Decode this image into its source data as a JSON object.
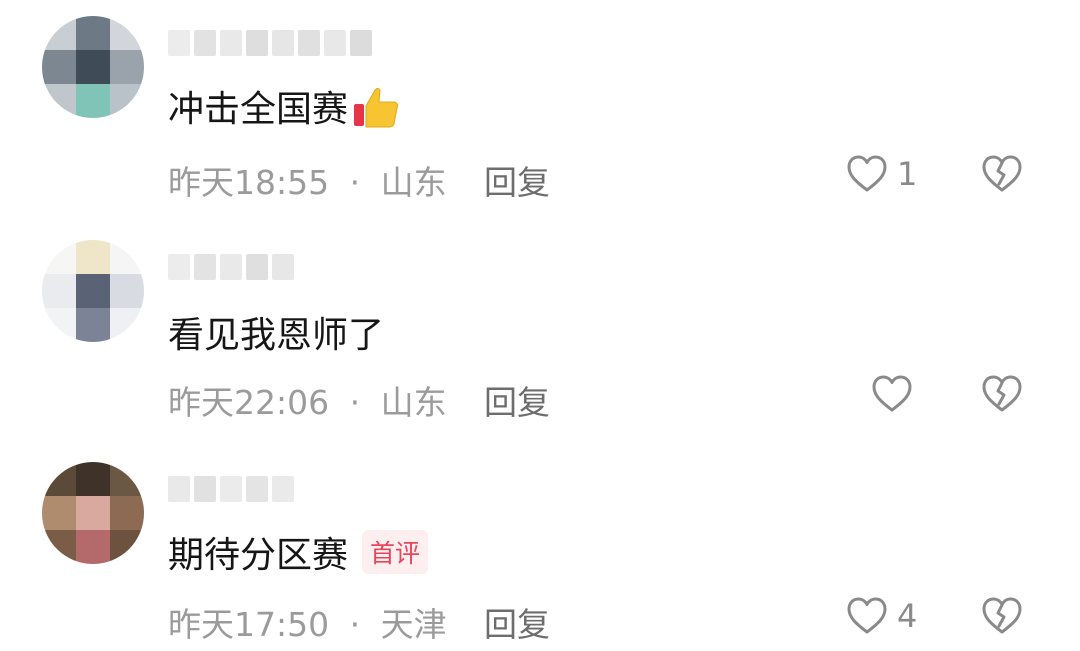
{
  "comments": [
    {
      "text": "冲击全国赛",
      "emoji_icon": "thumbs-up-icon",
      "time": "昨天18:55",
      "separator": "·",
      "location": "山东",
      "reply_label": "回复",
      "like_count": "1",
      "badge": ""
    },
    {
      "text": "看见我恩师了",
      "time": "昨天22:06",
      "separator": "·",
      "location": "山东",
      "reply_label": "回复",
      "like_count": "",
      "badge": ""
    },
    {
      "text": "期待分区赛",
      "badge": "首评",
      "time": "昨天17:50",
      "separator": "·",
      "location": "天津",
      "reply_label": "回复",
      "like_count": "4"
    }
  ],
  "colors": {
    "badge_text": "#e8455a",
    "badge_bg": "#fdeef0",
    "meta_text": "#9b9b9b",
    "body_text": "#161616"
  }
}
